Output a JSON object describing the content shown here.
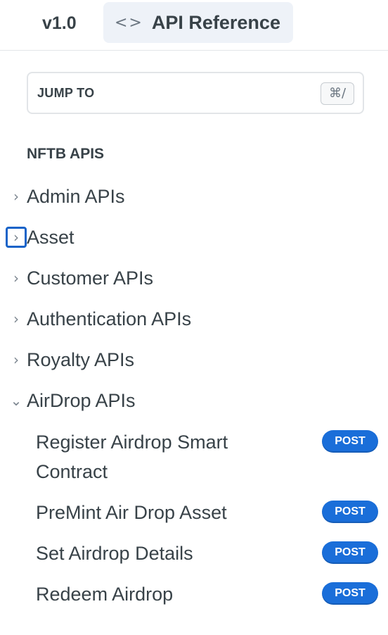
{
  "header": {
    "version": "v1.0",
    "api_tab": {
      "icon": "code-icon",
      "icon_glyph": "<>",
      "label": "API Reference"
    }
  },
  "jump_to": {
    "label": "JUMP TO",
    "shortcut": "⌘/"
  },
  "sidebar": {
    "section_title": "NFTB APIS",
    "items": [
      {
        "label": "Admin APIs",
        "expanded": false,
        "chevron": "›"
      },
      {
        "label": "Asset",
        "expanded": false,
        "chevron": "›"
      },
      {
        "label": "Customer APIs",
        "expanded": false,
        "chevron": "›"
      },
      {
        "label": "Authentication APIs",
        "expanded": false,
        "chevron": "›"
      },
      {
        "label": "Royalty APIs",
        "expanded": false,
        "chevron": "›"
      },
      {
        "label": "AirDrop APIs",
        "expanded": true,
        "chevron": "⌄"
      }
    ],
    "airdrop_children": [
      {
        "label": "Register Airdrop Smart Contract",
        "method": "POST"
      },
      {
        "label": "PreMint Air Drop Asset",
        "method": "POST"
      },
      {
        "label": "Set Airdrop Details",
        "method": "POST"
      },
      {
        "label": "Redeem Airdrop",
        "method": "POST"
      }
    ]
  },
  "colors": {
    "accent": "#1a6ed9",
    "focus": "#1863c8",
    "text": "#384248",
    "tab_bg": "#eef2f8"
  }
}
